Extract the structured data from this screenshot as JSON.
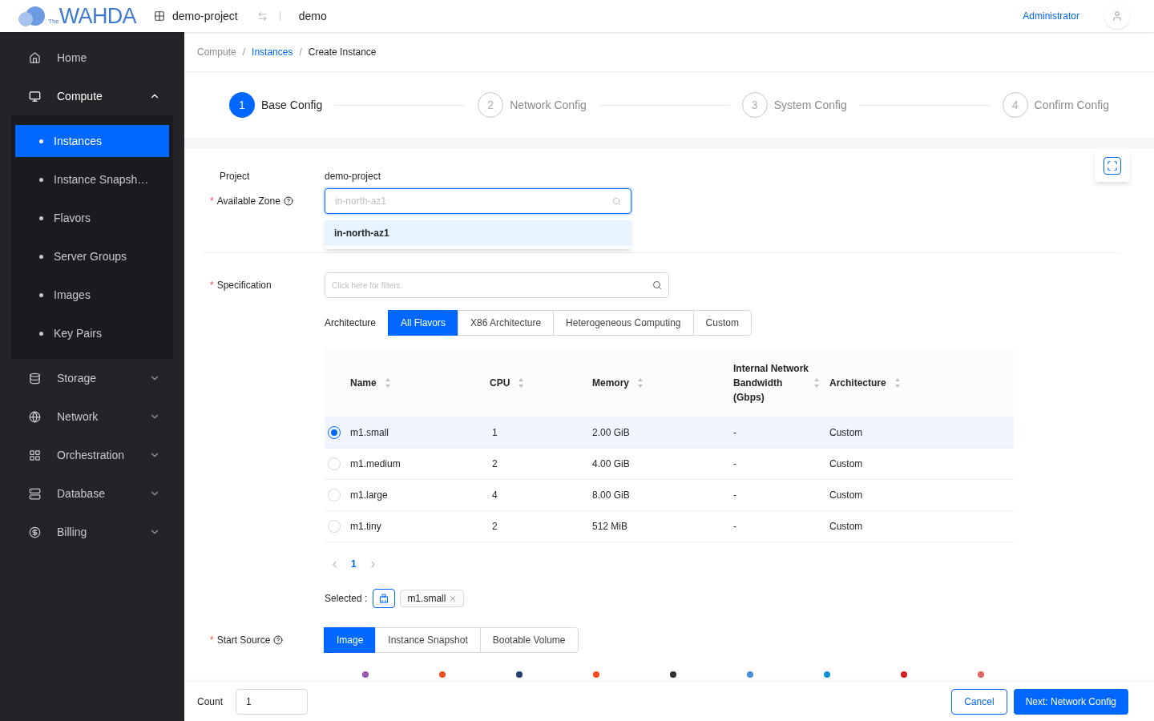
{
  "header": {
    "logo_small": "The",
    "logo": "WAHDA",
    "project": "demo-project",
    "region": "demo",
    "user": "Administrator"
  },
  "sidebar": {
    "items": [
      {
        "label": "Home",
        "selected": false
      },
      {
        "label": "Compute",
        "selected": true,
        "expanded": true,
        "children": [
          {
            "label": "Instances",
            "selected": true
          },
          {
            "label": "Instance Snapsh…",
            "selected": false
          },
          {
            "label": "Flavors",
            "selected": false
          },
          {
            "label": "Server Groups",
            "selected": false
          },
          {
            "label": "Images",
            "selected": false
          },
          {
            "label": "Key Pairs",
            "selected": false
          }
        ]
      },
      {
        "label": "Storage",
        "selected": false,
        "expanded": false
      },
      {
        "label": "Network",
        "selected": false,
        "expanded": false
      },
      {
        "label": "Orchestration",
        "selected": false,
        "expanded": false
      },
      {
        "label": "Database",
        "selected": false,
        "expanded": false
      },
      {
        "label": "Billing",
        "selected": false,
        "expanded": false
      }
    ]
  },
  "breadcrumb": [
    {
      "label": "Compute",
      "kind": "plain"
    },
    {
      "separator": "/",
      "label": "Instances",
      "kind": "link"
    },
    {
      "separator": "/",
      "label": "Create Instance",
      "kind": "current"
    }
  ],
  "steps": [
    {
      "number": "1",
      "label": "Base Config",
      "selected": true
    },
    {
      "number": "2",
      "label": "Network Config",
      "selected": false
    },
    {
      "number": "3",
      "label": "System Config",
      "selected": false
    },
    {
      "number": "4",
      "label": "Confirm Config",
      "selected": false
    }
  ],
  "project": {
    "label": "Project",
    "value": "demo-project"
  },
  "zone": {
    "label": "Available Zone",
    "required_mark": "*",
    "placeholder": "in-north-az1",
    "options": [
      {
        "label": "in-north-az1",
        "selected": true
      }
    ]
  },
  "specification": {
    "label": "Specification",
    "required_mark": "*",
    "placeholder": "Click here for filters.",
    "architecture_label": "Architecture",
    "tabs": [
      {
        "label": "All Flavors",
        "selected": true
      },
      {
        "label": "X86 Architecture",
        "selected": false
      },
      {
        "label": "Heterogeneous Computing",
        "selected": false
      },
      {
        "label": "Custom",
        "selected": false
      }
    ],
    "columns": [
      "Name",
      "CPU",
      "Memory",
      "Internal Network Bandwidth (Gbps)",
      "Architecture"
    ],
    "rows": [
      {
        "name": "m1.small",
        "cpu": "1",
        "memory": "2.00 GiB",
        "bandwidth": "-",
        "architecture": "Custom",
        "selected": true
      },
      {
        "name": "m1.medium",
        "cpu": "2",
        "memory": "4.00 GiB",
        "bandwidth": "-",
        "architecture": "Custom",
        "selected": false
      },
      {
        "name": "m1.large",
        "cpu": "4",
        "memory": "8.00 GiB",
        "bandwidth": "-",
        "architecture": "Custom",
        "selected": false
      },
      {
        "name": "m1.tiny",
        "cpu": "2",
        "memory": "512 MiB",
        "bandwidth": "-",
        "architecture": "Custom",
        "selected": false
      }
    ],
    "page": "1",
    "selected_label": "Selected :",
    "selected_tags": [
      "m1.small"
    ]
  },
  "start_source": {
    "label": "Start Source",
    "required_mark": "*",
    "tabs": [
      {
        "label": "Image",
        "selected": true
      },
      {
        "label": "Instance Snapshot",
        "selected": false
      },
      {
        "label": "Bootable Volume",
        "selected": false
      }
    ]
  },
  "footer": {
    "count_label": "Count",
    "count_value": "1",
    "cancel": "Cancel",
    "next": "Next: Network Config"
  }
}
